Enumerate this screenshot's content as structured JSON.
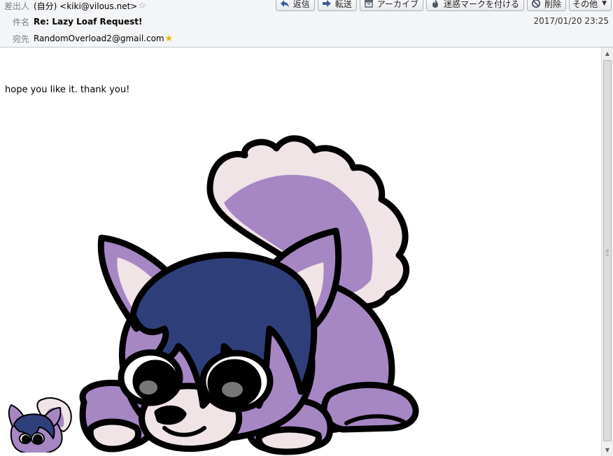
{
  "header": {
    "from_label": "差出人",
    "from_value": "(自分) <kiki@vilous.net>",
    "subject_label": "件名",
    "subject_value": "Re: Lazy Loaf Request!",
    "to_label": "宛先",
    "to_value": "RandomOverload2@gmail.com",
    "date": "2017/01/20 23:25"
  },
  "toolbar": {
    "reply_label": "返信",
    "forward_label": "転送",
    "archive_label": "アーカイブ",
    "junk_label": "迷惑マークを付ける",
    "delete_label": "削除",
    "other_label": "その他"
  },
  "message": {
    "text": "hope you like it. thank you!"
  },
  "colors": {
    "fur_purple": "#a687c4",
    "fur_light": "#f0e4e6",
    "hair_navy": "#2f3f7a",
    "outline": "#000000",
    "star_full": "#f0b400"
  },
  "icons": {
    "reply": "reply-arrow-icon",
    "forward": "forward-arrow-icon",
    "archive": "archive-box-icon",
    "junk": "junk-flame-icon",
    "delete": "no-entry-icon",
    "star_empty": "star-outline-icon",
    "star_full": "star-filled-icon"
  }
}
